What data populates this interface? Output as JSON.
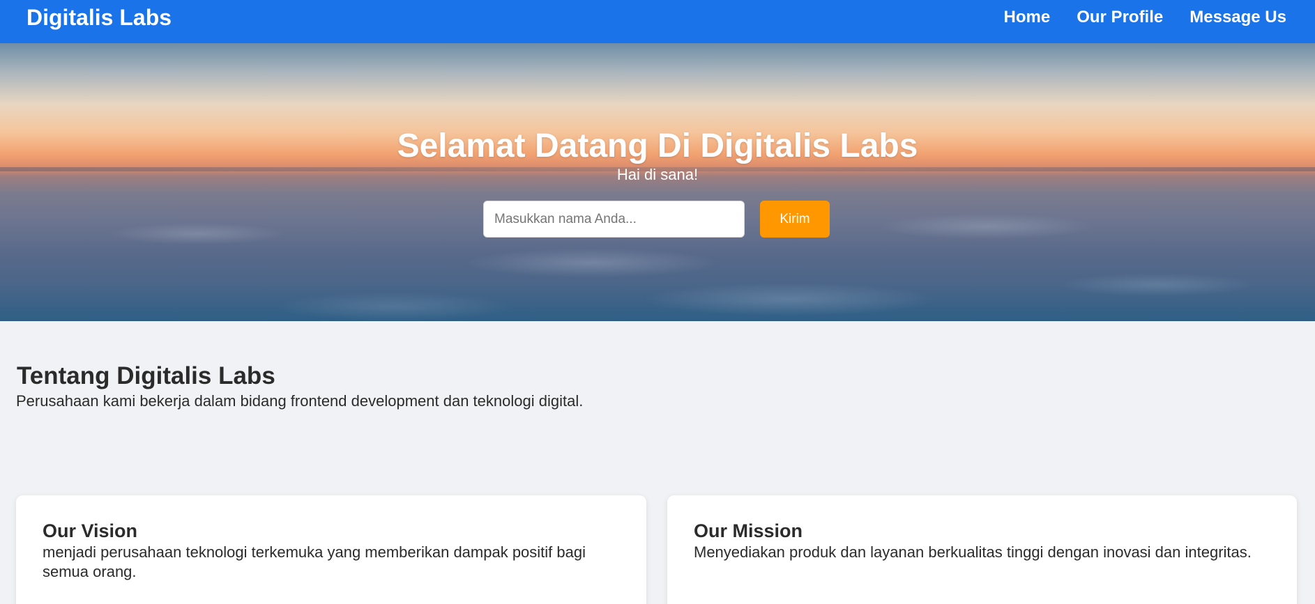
{
  "navbar": {
    "brand": "Digitalis Labs",
    "links": [
      "Home",
      "Our Profile",
      "Message Us"
    ]
  },
  "hero": {
    "title": "Selamat Datang Di Digitalis Labs",
    "subtitle": "Hai di sana!",
    "input_placeholder": "Masukkan nama Anda...",
    "input_value": "",
    "button_label": "Kirim"
  },
  "about": {
    "title": "Tentang Digitalis Labs",
    "text": "Perusahaan kami bekerja dalam bidang frontend development dan teknologi digital."
  },
  "cards": [
    {
      "title": "Our Vision",
      "text": "menjadi perusahaan teknologi terkemuka yang memberikan dampak positif bagi semua orang."
    },
    {
      "title": "Our Mission",
      "text": "Menyediakan produk dan layanan berkualitas tinggi dengan inovasi dan integritas."
    }
  ],
  "colors": {
    "navbar": "#1a73e8",
    "button": "#ff9800",
    "page_background": "#f1f2f5"
  }
}
